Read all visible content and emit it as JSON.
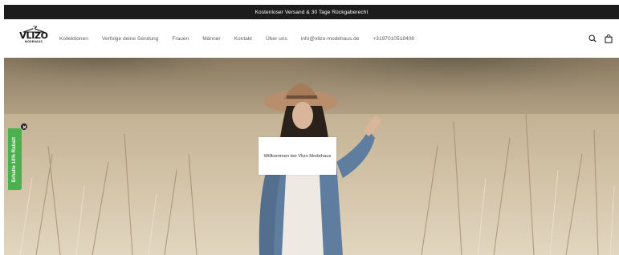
{
  "announcement": {
    "text": "Kostenloser Versand & 30 Tage Rückgaberecht"
  },
  "logo": {
    "word": "VLIZO",
    "sub": "MODEHAUS"
  },
  "nav": {
    "items": [
      {
        "label": "Kollektionen"
      },
      {
        "label": "Verfolge deine Sendung"
      },
      {
        "label": "Frauen"
      },
      {
        "label": "Männer"
      },
      {
        "label": "Kontakt"
      },
      {
        "label": "Über uns"
      },
      {
        "label": "info@vlizo-modehaus.de"
      },
      {
        "label": "+3197010518408"
      }
    ]
  },
  "header_icons": [
    "search-icon",
    "bag-icon"
  ],
  "hero": {
    "welcome_text": "Willkommen bei Vlizo Modehaus"
  },
  "discount_tab": {
    "label": "Erhalte 10% Rabatt",
    "color": "#4caf50"
  },
  "colors": {
    "announcement_bg": "#1c1c1c",
    "accent_green": "#4caf50"
  }
}
